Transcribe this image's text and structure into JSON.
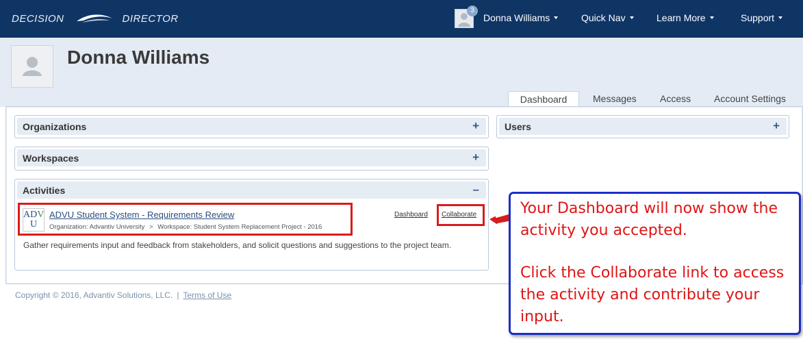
{
  "app": {
    "logo_left": "DECISION",
    "logo_right": "DIRECTOR"
  },
  "topnav": {
    "notification_count": "3",
    "user_menu": "Donna Williams",
    "quick_nav": "Quick Nav",
    "learn_more": "Learn More",
    "support": "Support"
  },
  "profile": {
    "name": "Donna Williams"
  },
  "tabs": [
    {
      "label": "Dashboard",
      "active": true
    },
    {
      "label": "Messages",
      "active": false
    },
    {
      "label": "Access",
      "active": false
    },
    {
      "label": "Account Settings",
      "active": false
    }
  ],
  "panels": {
    "organizations": {
      "title": "Organizations",
      "toggle": "+"
    },
    "workspaces": {
      "title": "Workspaces",
      "toggle": "+"
    },
    "activities": {
      "title": "Activities",
      "toggle": "–"
    },
    "users": {
      "title": "Users",
      "toggle": "+"
    }
  },
  "activity": {
    "logo_line1_a": "AD",
    "logo_line1_b": "V",
    "logo_line2": "U",
    "title": "ADVU Student System - Requirements Review",
    "organization": "Organization: Advantiv University",
    "separator": ">",
    "workspace": "Workspace: Student System Replacement Project - 2016",
    "dashboard_link": "Dashboard",
    "collaborate_link": "Collaborate",
    "description": "Gather requirements input and feedback from stakeholders, and solicit questions and suggestions to the project team."
  },
  "footer": {
    "copyright": "Copyright © 2016, Advantiv Solutions, LLC.",
    "separator": "|",
    "terms": "Terms of Use"
  },
  "callout": {
    "line1": "Your Dashboard will now show the activity you accepted.",
    "line2": "Click the Collaborate link to access the activity and contribute your input."
  },
  "colors": {
    "topbar": "#0f3565",
    "accent_red": "#d81c1c",
    "callout_border": "#1b2ec8",
    "link": "#2b4f80"
  }
}
